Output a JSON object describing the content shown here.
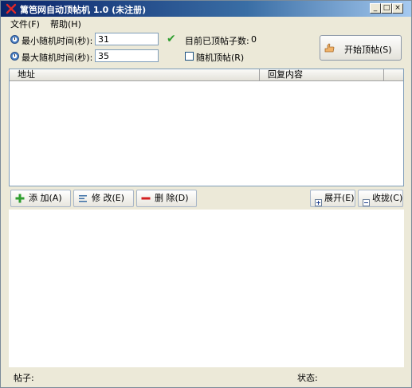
{
  "window": {
    "title": "篱笆网自动顶帖机 1.0 (未注册)",
    "controls": [
      "_",
      "□",
      "×"
    ]
  },
  "menu": [
    {
      "label": "文件(F)"
    },
    {
      "label": "帮助(H)"
    }
  ],
  "settings": {
    "min_label": "最小随机时间(秒):",
    "min_value": "31",
    "max_label": "最大随机时间(秒):",
    "max_value": "35",
    "count_label": "目前已顶帖子数:",
    "count_value": "0",
    "random_label": "随机顶帖(R)",
    "random_checked": false,
    "start_label": "开始顶帖(S)"
  },
  "table": {
    "columns": [
      "地址",
      "回复内容"
    ],
    "rows": []
  },
  "toolbar": {
    "add": "添 加(A)",
    "edit": "修 改(E)",
    "delete": "删 除(D)",
    "expand": "展开(E)",
    "collapse": "收拢(C)"
  },
  "status": {
    "post_label": "帖子:",
    "state_label": "状态:"
  },
  "colors": {
    "titlebar": "#0a246a",
    "check": "#2f9e2f",
    "add_icon": "#2f9e2f",
    "delete_icon": "#d42020"
  }
}
